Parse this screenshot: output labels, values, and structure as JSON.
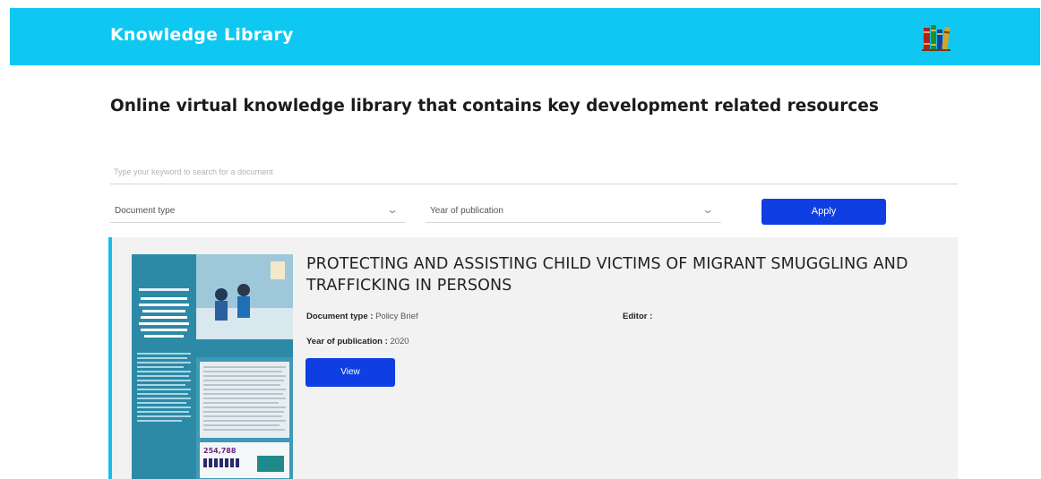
{
  "header": {
    "brand": "Knowledge Library",
    "logo_icon": "books-icon"
  },
  "tagline": "Online virtual knowledge library that contains key development related resources",
  "search": {
    "placeholder": "Type your keyword to search for a document",
    "value": ""
  },
  "filters": {
    "document_type": "Document type",
    "year": "Year of publication",
    "apply_label": "Apply"
  },
  "results": [
    {
      "title": "PROTECTING AND ASSISTING CHILD VICTIMS OF MIGRANT SMUGGLING AND TRAFFICKING IN PERSONS",
      "document_type_label": "Document type :",
      "document_type_value": "Policy Brief",
      "editor_label": "Editor :",
      "editor_value": "",
      "year_label": "Year of publication :",
      "year_value": "2020",
      "view_label": "View",
      "cover": {
        "kicker": "POLICY BRIEF",
        "heading": "PROTECTING AND ASSISTING CHILD VICTIMS OF MIGRANT SMUGGLING AND TRAFFICKING IN PERSONS",
        "stat": "254,788"
      }
    }
  ],
  "colors": {
    "header_bg": "#0ec8f2",
    "button_bg": "#0f3fe2",
    "card_bg": "#f2f2f2",
    "card_accent": "#17bfe8"
  }
}
